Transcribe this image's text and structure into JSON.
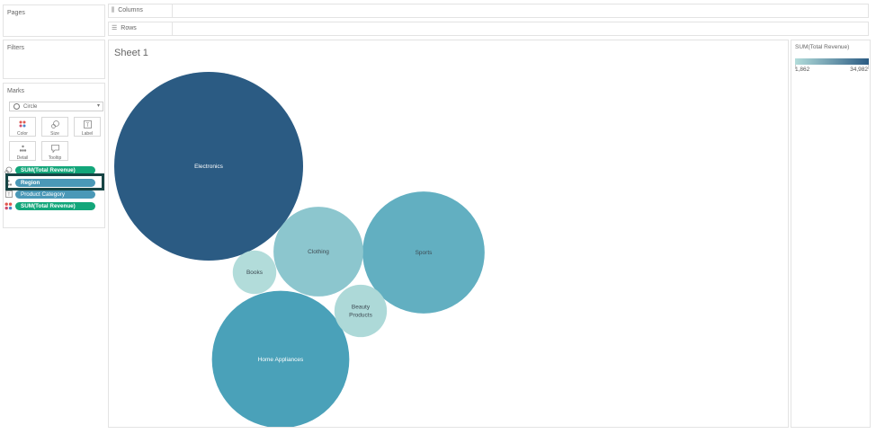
{
  "panels": {
    "pages": "Pages",
    "filters": "Filters",
    "marks": "Marks"
  },
  "marks_card": {
    "mark_type": "Circle",
    "buttons": [
      {
        "label": "Color",
        "icon": "color-dots-icon"
      },
      {
        "label": "Size",
        "icon": "size-icon"
      },
      {
        "label": "Label",
        "icon": "label-icon"
      },
      {
        "label": "Detail",
        "icon": "detail-icon"
      },
      {
        "label": "Tooltip",
        "icon": "tooltip-icon"
      }
    ],
    "pills": [
      {
        "label": "SUM(Total Revenue)",
        "type": "size",
        "color": "#13a67a"
      },
      {
        "label": "Region",
        "type": "detail",
        "color": "#4a98b7"
      },
      {
        "label": "Product Category",
        "type": "label",
        "color": "#4a98b7"
      },
      {
        "label": "SUM(Total Revenue)",
        "type": "color",
        "color": "#13a67a"
      }
    ]
  },
  "shelves": {
    "columns": "Columns",
    "rows": "Rows"
  },
  "sheet": {
    "title": "Sheet 1"
  },
  "legend": {
    "title": "SUM(Total Revenue)",
    "min": "1,862",
    "max": "34,982",
    "min_color": "#b2dcda",
    "max_color": "#2b5b83"
  },
  "chart_data": {
    "type": "packed-bubble",
    "categories": [
      "Electronics",
      "Sports",
      "Home Appliances",
      "Clothing",
      "Beauty Products",
      "Books"
    ],
    "values": [
      34982,
      14600,
      18500,
      7900,
      2700,
      1862
    ],
    "color_range": [
      1862,
      34982
    ]
  }
}
